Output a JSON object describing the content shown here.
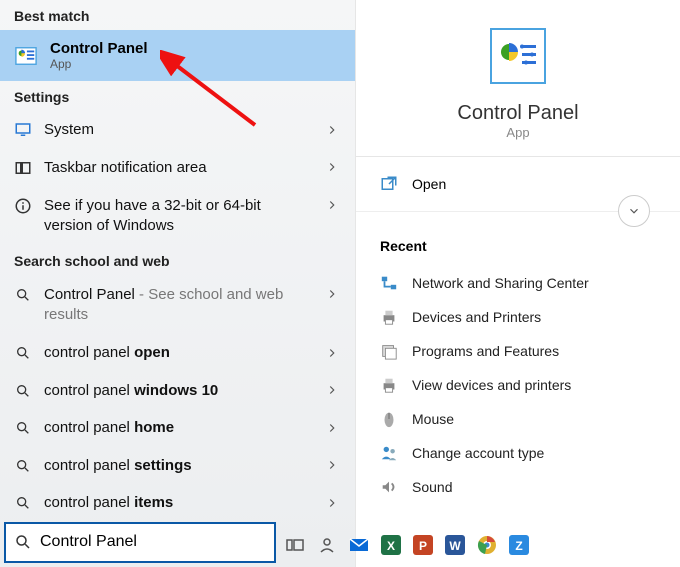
{
  "left": {
    "best_match_header": "Best match",
    "best_match": {
      "title": "Control Panel",
      "subtitle": "App"
    },
    "settings_header": "Settings",
    "settings": [
      {
        "icon": "monitor-icon",
        "label": "System"
      },
      {
        "icon": "allapps-icon",
        "label": "Taskbar notification area"
      },
      {
        "icon": "info-icon",
        "label": "See if you have a 32-bit or 64-bit version of Windows"
      }
    ],
    "search_web_header": "Search school and web",
    "search_web": [
      {
        "prefix": "Control Panel",
        "bold": "",
        "hint": " - See school and web results"
      },
      {
        "prefix": "control panel ",
        "bold": "open",
        "hint": ""
      },
      {
        "prefix": "control panel ",
        "bold": "windows 10",
        "hint": ""
      },
      {
        "prefix": "control panel ",
        "bold": "home",
        "hint": ""
      },
      {
        "prefix": "control panel ",
        "bold": "settings",
        "hint": ""
      },
      {
        "prefix": "control panel ",
        "bold": "items",
        "hint": ""
      }
    ],
    "search_value": "Control Panel"
  },
  "right": {
    "title": "Control Panel",
    "subtitle": "App",
    "open_label": "Open",
    "recent_header": "Recent",
    "recent": [
      "Network and Sharing Center",
      "Devices and Printers",
      "Programs and Features",
      "View devices and printers",
      "Mouse",
      "Change account type",
      "Sound"
    ]
  },
  "taskbar": [
    "task-view-icon",
    "people-icon",
    "mail-icon",
    "excel-icon",
    "powerpoint-icon",
    "word-icon",
    "chrome-icon",
    "zalo-icon"
  ]
}
